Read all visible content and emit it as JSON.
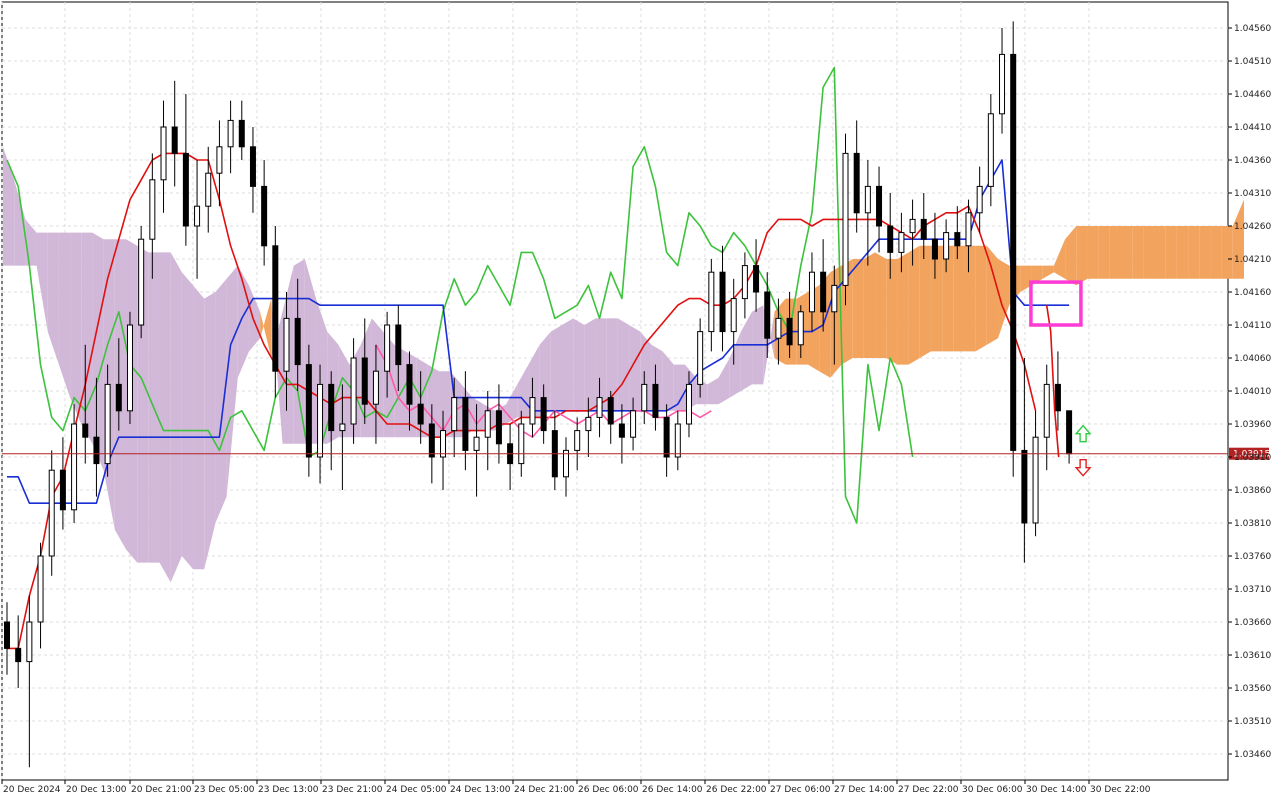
{
  "chart_data": {
    "type": "candlestick",
    "title": "",
    "xlabel": "",
    "ylabel": "",
    "ylim": [
      1.0342,
      1.0459
    ],
    "grid": true,
    "price_ticks": [
      "1.04560",
      "1.04510",
      "1.04460",
      "1.04410",
      "1.04360",
      "1.04310",
      "1.04260",
      "1.04210",
      "1.04160",
      "1.04110",
      "1.04060",
      "1.04010",
      "1.03960",
      "1.03910",
      "1.03860",
      "1.03810",
      "1.03760",
      "1.03710",
      "1.03660",
      "1.03610",
      "1.03560",
      "1.03510",
      "1.03460"
    ],
    "time_ticks": [
      "20 Dec 2024",
      "20 Dec 13:00",
      "20 Dec 21:00",
      "23 Dec 05:00",
      "23 Dec 13:00",
      "23 Dec 21:00",
      "24 Dec 05:00",
      "24 Dec 13:00",
      "24 Dec 21:00",
      "26 Dec 06:00",
      "26 Dec 14:00",
      "26 Dec 22:00",
      "27 Dec 06:00",
      "27 Dec 14:00",
      "27 Dec 22:00",
      "30 Dec 06:00",
      "30 Dec 14:00",
      "30 Dec 22:00"
    ],
    "current_price": {
      "value": 1.03915,
      "label": "1.03915",
      "color": "#b22222"
    },
    "colors": {
      "tenkan": "#e01010",
      "kijun": "#1a2ed6",
      "chikou": "#3cc23c",
      "projection": "#ff5aa8",
      "cloud_bull": "#f2a35e",
      "cloud_bear": "#d2b8d8",
      "highlight_box": "#ff3ad5",
      "arrow_up": "#2ecc40",
      "arrow_down": "#e02020",
      "grid": "#dcdcdc"
    },
    "candles": [
      [
        1.0366,
        1.0369,
        1.0358,
        1.0362
      ],
      [
        1.0362,
        1.0367,
        1.0356,
        1.036
      ],
      [
        1.036,
        1.037,
        1.0344,
        1.0366
      ],
      [
        1.0366,
        1.0378,
        1.0362,
        1.0376
      ],
      [
        1.0376,
        1.0392,
        1.0373,
        1.0389
      ],
      [
        1.0389,
        1.0394,
        1.038,
        1.0383
      ],
      [
        1.0383,
        1.0399,
        1.0381,
        1.0396
      ],
      [
        1.0396,
        1.0408,
        1.039,
        1.0394
      ],
      [
        1.0394,
        1.0403,
        1.0385,
        1.039
      ],
      [
        1.039,
        1.0405,
        1.0388,
        1.0402
      ],
      [
        1.0402,
        1.0409,
        1.0395,
        1.0398
      ],
      [
        1.0398,
        1.0413,
        1.0396,
        1.0411
      ],
      [
        1.0411,
        1.0426,
        1.0409,
        1.0424
      ],
      [
        1.0424,
        1.0437,
        1.0418,
        1.0433
      ],
      [
        1.0433,
        1.0445,
        1.0428,
        1.0441
      ],
      [
        1.0441,
        1.0448,
        1.0432,
        1.0437
      ],
      [
        1.0437,
        1.0446,
        1.0423,
        1.0426
      ],
      [
        1.0426,
        1.0436,
        1.0418,
        1.0429
      ],
      [
        1.0429,
        1.0438,
        1.0425,
        1.0434
      ],
      [
        1.0434,
        1.0442,
        1.0429,
        1.0438
      ],
      [
        1.0438,
        1.0445,
        1.0434,
        1.0442
      ],
      [
        1.0442,
        1.0445,
        1.0436,
        1.0438
      ],
      [
        1.0438,
        1.0441,
        1.0428,
        1.0432
      ],
      [
        1.0432,
        1.0436,
        1.042,
        1.0423
      ],
      [
        1.0423,
        1.0426,
        1.04,
        1.0404
      ],
      [
        1.0404,
        1.0416,
        1.0398,
        1.0412
      ],
      [
        1.0412,
        1.0418,
        1.0401,
        1.0405
      ],
      [
        1.0405,
        1.0408,
        1.0388,
        1.0391
      ],
      [
        1.0391,
        1.0405,
        1.0387,
        1.0402
      ],
      [
        1.0402,
        1.0404,
        1.0389,
        1.0395
      ],
      [
        1.0395,
        1.0402,
        1.0386,
        1.0396
      ],
      [
        1.0396,
        1.0409,
        1.0393,
        1.0406
      ],
      [
        1.0406,
        1.0412,
        1.0396,
        1.0399
      ],
      [
        1.0399,
        1.0408,
        1.0393,
        1.0404
      ],
      [
        1.0404,
        1.0413,
        1.04,
        1.0411
      ],
      [
        1.0411,
        1.0414,
        1.0401,
        1.0405
      ],
      [
        1.0405,
        1.0407,
        1.0395,
        1.0399
      ],
      [
        1.0399,
        1.0404,
        1.0393,
        1.0396
      ],
      [
        1.0396,
        1.0399,
        1.0387,
        1.0391
      ],
      [
        1.0391,
        1.0398,
        1.0386,
        1.0395
      ],
      [
        1.0395,
        1.0403,
        1.0391,
        1.04
      ],
      [
        1.04,
        1.0404,
        1.0389,
        1.0392
      ],
      [
        1.0392,
        1.0399,
        1.0385,
        1.0394
      ],
      [
        1.0394,
        1.0401,
        1.0389,
        1.0398
      ],
      [
        1.0398,
        1.0402,
        1.039,
        1.0393
      ],
      [
        1.0393,
        1.0396,
        1.0386,
        1.039
      ],
      [
        1.039,
        1.0398,
        1.0388,
        1.0396
      ],
      [
        1.0396,
        1.0403,
        1.0394,
        1.04
      ],
      [
        1.04,
        1.0402,
        1.0393,
        1.0395
      ],
      [
        1.0395,
        1.0398,
        1.0386,
        1.0388
      ],
      [
        1.0388,
        1.0394,
        1.0385,
        1.0392
      ],
      [
        1.0392,
        1.0397,
        1.0389,
        1.0395
      ],
      [
        1.0395,
        1.04,
        1.0391,
        1.0397
      ],
      [
        1.0397,
        1.0403,
        1.0394,
        1.04
      ],
      [
        1.04,
        1.0401,
        1.0393,
        1.0396
      ],
      [
        1.0396,
        1.0399,
        1.039,
        1.0394
      ],
      [
        1.0394,
        1.04,
        1.0392,
        1.0398
      ],
      [
        1.0398,
        1.0404,
        1.0396,
        1.0402
      ],
      [
        1.0402,
        1.0405,
        1.0395,
        1.0397
      ],
      [
        1.0397,
        1.0399,
        1.0388,
        1.0391
      ],
      [
        1.0391,
        1.0398,
        1.0389,
        1.0396
      ],
      [
        1.0396,
        1.0404,
        1.0394,
        1.0402
      ],
      [
        1.0402,
        1.0412,
        1.04,
        1.041
      ],
      [
        1.041,
        1.0421,
        1.0407,
        1.0419
      ],
      [
        1.0419,
        1.0423,
        1.0407,
        1.041
      ],
      [
        1.041,
        1.0418,
        1.0405,
        1.0415
      ],
      [
        1.0415,
        1.0422,
        1.0412,
        1.042
      ],
      [
        1.042,
        1.0424,
        1.0413,
        1.0416
      ],
      [
        1.0416,
        1.0419,
        1.0406,
        1.0409
      ],
      [
        1.0409,
        1.0415,
        1.0405,
        1.0412
      ],
      [
        1.0412,
        1.0416,
        1.0406,
        1.0408
      ],
      [
        1.0408,
        1.0414,
        1.0406,
        1.0413
      ],
      [
        1.0413,
        1.0422,
        1.041,
        1.0419
      ],
      [
        1.0419,
        1.0424,
        1.041,
        1.0413
      ],
      [
        1.0413,
        1.042,
        1.0405,
        1.0417
      ],
      [
        1.0417,
        1.044,
        1.0414,
        1.0437
      ],
      [
        1.0437,
        1.0442,
        1.0425,
        1.0428
      ],
      [
        1.0428,
        1.0436,
        1.042,
        1.0432
      ],
      [
        1.0432,
        1.0435,
        1.0422,
        1.0426
      ],
      [
        1.0426,
        1.0431,
        1.0418,
        1.0422
      ],
      [
        1.0422,
        1.0428,
        1.0419,
        1.0425
      ],
      [
        1.0425,
        1.043,
        1.042,
        1.0427
      ],
      [
        1.0427,
        1.0431,
        1.0421,
        1.0424
      ],
      [
        1.0424,
        1.0428,
        1.0418,
        1.0421
      ],
      [
        1.0421,
        1.0427,
        1.0419,
        1.0425
      ],
      [
        1.0425,
        1.0429,
        1.0421,
        1.0423
      ],
      [
        1.0423,
        1.043,
        1.0419,
        1.0428
      ],
      [
        1.0428,
        1.0435,
        1.0425,
        1.0432
      ],
      [
        1.0432,
        1.0446,
        1.0429,
        1.0443
      ],
      [
        1.0443,
        1.0456,
        1.044,
        1.0452
      ],
      [
        1.0452,
        1.0457,
        1.0388,
        1.0392
      ],
      [
        1.0392,
        1.0406,
        1.0375,
        1.0381
      ],
      [
        1.0381,
        1.0398,
        1.0379,
        1.0394
      ],
      [
        1.0394,
        1.0405,
        1.0389,
        1.0402
      ],
      [
        1.0402,
        1.0407,
        1.0395,
        1.0398
      ],
      [
        1.0398,
        1.03915,
        1.039,
        1.03915
      ]
    ],
    "tenkan": [
      1.0362,
      1.0362,
      1.037,
      1.0376,
      1.0385,
      1.0388,
      1.0395,
      1.0402,
      1.041,
      1.0418,
      1.0424,
      1.043,
      1.0433,
      1.0436,
      1.0437,
      1.0437,
      1.0437,
      1.0436,
      1.0436,
      1.043,
      1.0423,
      1.0418,
      1.0412,
      1.0408,
      1.0405,
      1.0402,
      1.0402,
      1.0401,
      1.04,
      1.0399,
      1.04,
      1.04,
      1.04,
      1.0398,
      1.0396,
      1.0396,
      1.0396,
      1.0395,
      1.0394,
      1.0394,
      1.0395,
      1.0395,
      1.0395,
      1.0395,
      1.0396,
      1.0396,
      1.0397,
      1.0397,
      1.0397,
      1.0397,
      1.0398,
      1.0398,
      1.0398,
      1.0399,
      1.04,
      1.0402,
      1.0405,
      1.0408,
      1.041,
      1.0412,
      1.0414,
      1.0415,
      1.0415,
      1.0414,
      1.0414,
      1.0415,
      1.0417,
      1.042,
      1.0425,
      1.0427,
      1.0427,
      1.0427,
      1.0426,
      1.0427,
      1.0427,
      1.0427,
      1.0427,
      1.0427,
      1.0427,
      1.0426,
      1.0425,
      1.0424,
      1.0426,
      1.0427,
      1.0428,
      1.0428,
      1.0429,
      1.0425,
      1.042,
      1.0414,
      1.041,
      1.0405,
      1.0398
    ],
    "kijun": [
      1.0388,
      1.0388,
      1.0384,
      1.0384,
      1.0384,
      1.0384,
      1.0384,
      1.0384,
      1.0384,
      1.039,
      1.0394,
      1.0394,
      1.0394,
      1.0394,
      1.0394,
      1.0394,
      1.0394,
      1.0394,
      1.0394,
      1.0394,
      1.0408,
      1.0412,
      1.0415,
      1.0415,
      1.0415,
      1.0415,
      1.0415,
      1.0415,
      1.0414,
      1.0414,
      1.0414,
      1.0414,
      1.0414,
      1.0414,
      1.0414,
      1.0414,
      1.0414,
      1.0414,
      1.0414,
      1.0414,
      1.04,
      1.04,
      1.04,
      1.04,
      1.04,
      1.04,
      1.04,
      1.0398,
      1.0398,
      1.0398,
      1.0398,
      1.0398,
      1.0398,
      1.0398,
      1.0398,
      1.0398,
      1.0398,
      1.0398,
      1.0398,
      1.0398,
      1.0399,
      1.0402,
      1.0404,
      1.0405,
      1.0406,
      1.0408,
      1.0408,
      1.0408,
      1.0408,
      1.0409,
      1.041,
      1.041,
      1.041,
      1.0411,
      1.0416,
      1.0418,
      1.042,
      1.0422,
      1.0424,
      1.0424,
      1.0424,
      1.0424,
      1.0424,
      1.0424,
      1.0424,
      1.0424,
      1.0424,
      1.043,
      1.0433,
      1.0436,
      1.0416,
      1.0414,
      1.0414,
      1.0414,
      1.0414,
      1.0414
    ],
    "chikou": [
      1.0436,
      1.0432,
      1.042,
      1.0405,
      1.0397,
      1.0395,
      1.04,
      1.0398,
      1.0402,
      1.0408,
      1.0413,
      1.0405,
      1.0403,
      1.0399,
      1.0395,
      1.0395,
      1.0395,
      1.0395,
      1.0395,
      1.0392,
      1.0397,
      1.0398,
      1.0395,
      1.0392,
      1.04,
      1.0403,
      1.0401,
      1.0391,
      1.0392,
      1.0398,
      1.0403,
      1.0401,
      1.0397,
      1.0398,
      1.0397,
      1.04,
      1.0403,
      1.04,
      1.0404,
      1.0413,
      1.0418,
      1.0414,
      1.0416,
      1.042,
      1.0417,
      1.0414,
      1.0422,
      1.0422,
      1.0418,
      1.0412,
      1.0413,
      1.0414,
      1.0417,
      1.0412,
      1.0419,
      1.0415,
      1.0435,
      1.0438,
      1.0432,
      1.0422,
      1.042,
      1.0428,
      1.0426,
      1.0423,
      1.0422,
      1.0425,
      1.0423,
      1.042,
      1.0417,
      1.0413,
      1.041,
      1.042,
      1.0428,
      1.0447,
      1.045,
      1.0385,
      1.0381,
      1.0405,
      1.0395,
      1.0406,
      1.0402,
      1.0391
    ],
    "cloud": [
      [
        1.0438,
        1.042
      ],
      [
        1.0433,
        1.042
      ],
      [
        1.0427,
        1.042
      ],
      [
        1.0425,
        1.042
      ],
      [
        1.0425,
        1.041
      ],
      [
        1.0425,
        1.0405
      ],
      [
        1.0425,
        1.04
      ],
      [
        1.0425,
        1.0396
      ],
      [
        1.0425,
        1.0393
      ],
      [
        1.0424,
        1.0389
      ],
      [
        1.0424,
        1.038
      ],
      [
        1.0424,
        1.0377
      ],
      [
        1.0423,
        1.0375
      ],
      [
        1.0422,
        1.0375
      ],
      [
        1.0422,
        1.0375
      ],
      [
        1.0422,
        1.0372
      ],
      [
        1.0419,
        1.0376
      ],
      [
        1.0417,
        1.0374
      ],
      [
        1.0415,
        1.0374
      ],
      [
        1.0416,
        1.0381
      ],
      [
        1.0418,
        1.0385
      ],
      [
        1.042,
        1.0403
      ],
      [
        1.0417,
        1.0407
      ],
      [
        1.0413,
        1.0409
      ],
      [
        1.0406,
        1.0415
      ],
      [
        1.0413,
        1.0393
      ],
      [
        1.042,
        1.0393
      ],
      [
        1.0421,
        1.0393
      ],
      [
        1.0415,
        1.0393
      ],
      [
        1.041,
        1.0393
      ],
      [
        1.0408,
        1.0394
      ],
      [
        1.0405,
        1.0394
      ],
      [
        1.0408,
        1.0394
      ],
      [
        1.0412,
        1.0394
      ],
      [
        1.041,
        1.0394
      ],
      [
        1.0408,
        1.0394
      ],
      [
        1.0407,
        1.0394
      ],
      [
        1.0406,
        1.0394
      ],
      [
        1.0405,
        1.0394
      ],
      [
        1.0404,
        1.0394
      ],
      [
        1.0404,
        1.0394
      ],
      [
        1.0402,
        1.0394
      ],
      [
        1.04,
        1.0395
      ],
      [
        1.0399,
        1.0395
      ],
      [
        1.0398,
        1.0395
      ],
      [
        1.0399,
        1.0396
      ],
      [
        1.0402,
        1.0397
      ],
      [
        1.0405,
        1.0397
      ],
      [
        1.0408,
        1.0397
      ],
      [
        1.041,
        1.0398
      ],
      [
        1.0411,
        1.0398
      ],
      [
        1.0412,
        1.0398
      ],
      [
        1.0411,
        1.0398
      ],
      [
        1.0412,
        1.0398
      ],
      [
        1.0412,
        1.0398
      ],
      [
        1.0412,
        1.0398
      ],
      [
        1.0411,
        1.0398
      ],
      [
        1.041,
        1.0398
      ],
      [
        1.0408,
        1.0398
      ],
      [
        1.0407,
        1.0398
      ],
      [
        1.0405,
        1.0398
      ],
      [
        1.0405,
        1.0398
      ],
      [
        1.0403,
        1.0399
      ],
      [
        1.0402,
        1.0399
      ],
      [
        1.0403,
        1.0399
      ],
      [
        1.0406,
        1.04
      ],
      [
        1.041,
        1.0401
      ],
      [
        1.0413,
        1.0402
      ],
      [
        1.0414,
        1.0402
      ],
      [
        1.0406,
        1.0413
      ],
      [
        1.0405,
        1.0415
      ],
      [
        1.0405,
        1.0415
      ],
      [
        1.0405,
        1.0416
      ],
      [
        1.0404,
        1.0417
      ],
      [
        1.0403,
        1.0419
      ],
      [
        1.0405,
        1.042
      ],
      [
        1.0406,
        1.0421
      ],
      [
        1.0406,
        1.0421
      ],
      [
        1.0406,
        1.0422
      ],
      [
        1.0406,
        1.0421
      ],
      [
        1.0405,
        1.0421
      ],
      [
        1.0405,
        1.0422
      ],
      [
        1.0406,
        1.0423
      ],
      [
        1.0407,
        1.0423
      ],
      [
        1.0407,
        1.0423
      ],
      [
        1.0407,
        1.0423
      ],
      [
        1.0407,
        1.0423
      ],
      [
        1.0407,
        1.0423
      ],
      [
        1.0408,
        1.0423
      ],
      [
        1.0409,
        1.0421
      ],
      [
        1.0414,
        1.042
      ],
      [
        1.0416,
        1.042
      ],
      [
        1.0417,
        1.042
      ],
      [
        1.0418,
        1.042
      ],
      [
        1.0419,
        1.042
      ],
      [
        1.0418,
        1.0424
      ],
      [
        1.0417,
        1.0426
      ],
      [
        1.0418,
        1.0426
      ],
      [
        1.0418,
        1.0426
      ],
      [
        1.0418,
        1.0426
      ],
      [
        1.0418,
        1.0426
      ],
      [
        1.0418,
        1.0426
      ],
      [
        1.0418,
        1.0426
      ],
      [
        1.0418,
        1.0426
      ],
      [
        1.0418,
        1.0426
      ],
      [
        1.0418,
        1.0426
      ],
      [
        1.0418,
        1.0426
      ],
      [
        1.0418,
        1.0426
      ],
      [
        1.0418,
        1.0426
      ],
      [
        1.0418,
        1.0426
      ],
      [
        1.0418,
        1.0426
      ],
      [
        1.0418,
        1.043
      ]
    ],
    "projection": [
      1.0408,
      1.0405,
      1.04,
      1.0398,
      1.0399,
      1.0397,
      1.0395,
      1.0398,
      1.0399,
      1.0396,
      1.0398,
      1.0399,
      1.0397,
      1.0395,
      1.0394,
      1.0396,
      1.0398,
      1.0397,
      1.0396,
      1.0397,
      1.0398,
      1.0396,
      1.0397,
      1.0398,
      1.0398,
      1.0397,
      1.0397,
      1.0398,
      1.0398,
      1.0397,
      1.0398
    ],
    "forecast": [
      1.0414,
      1.041,
      1.0398,
      1.0391
    ],
    "signals": [
      {
        "type": "buy",
        "direction": "up"
      },
      {
        "type": "sell",
        "direction": "down"
      }
    ]
  }
}
